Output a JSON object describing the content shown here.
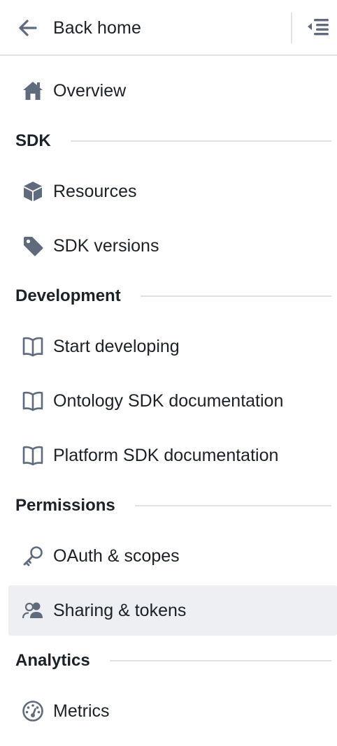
{
  "header": {
    "back_label": "Back home",
    "back_icon": "arrow-left-icon",
    "collapse_icon": "menu-closed-icon"
  },
  "nav": {
    "overview": {
      "label": "Overview",
      "icon": "home-icon"
    },
    "sections": {
      "sdk": "SDK",
      "development": "Development",
      "permissions": "Permissions",
      "analytics": "Analytics"
    },
    "items": {
      "resources": {
        "label": "Resources",
        "icon": "cube-icon"
      },
      "sdk_versions": {
        "label": "SDK versions",
        "icon": "tag-icon"
      },
      "start_developing": {
        "label": "Start developing",
        "icon": "book-icon"
      },
      "ontology_sdk_docs": {
        "label": "Ontology SDK documentation",
        "icon": "book-icon"
      },
      "platform_sdk_docs": {
        "label": "Platform SDK documentation",
        "icon": "book-icon"
      },
      "oauth_scopes": {
        "label": "OAuth & scopes",
        "icon": "key-icon"
      },
      "sharing_tokens": {
        "label": "Sharing & tokens",
        "icon": "people-icon",
        "active": true
      },
      "metrics": {
        "label": "Metrics",
        "icon": "dashboard-icon"
      }
    }
  },
  "colors": {
    "icon": "#5f6b7c",
    "text": "#1c2127",
    "active_bg": "#edeff2",
    "divider": "#e1e3e6"
  }
}
